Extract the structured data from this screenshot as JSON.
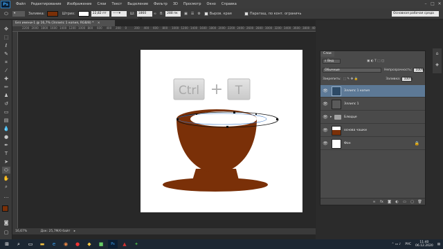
{
  "app": {
    "logo": "Ps"
  },
  "menu": [
    "Файл",
    "Редактирование",
    "Изображение",
    "Слои",
    "Текст",
    "Выделение",
    "Фильтр",
    "3D",
    "Просмотр",
    "Окно",
    "Справка"
  ],
  "options": {
    "fill_label": "Заливка:",
    "stroke_label": "Штрих:",
    "stroke_width": "22,82 пт",
    "w_label": "Ш:",
    "w_value": "1860 пк",
    "h_label": "В:",
    "h_value": "288 пк",
    "align_label": "Выров. края",
    "constrain_label": "Паратащ. по конт. ограничь",
    "workspace": "Основная рабочая среда",
    "fill_color": "#7a3008",
    "stroke_color": "#ffffff"
  },
  "document": {
    "tab_title": "Без имени-1 @ 16,7% (Эллипс 1 копия, RGB/8) *",
    "zoom": "16,67%",
    "doc_info": "Док: 25,7M/0 байт"
  },
  "ruler_ticks": [
    "2200",
    "2000",
    "1800",
    "1600",
    "1400",
    "1200",
    "1000",
    "800",
    "600",
    "400",
    "200",
    "0",
    "200",
    "400",
    "600",
    "800",
    "1000",
    "1200",
    "1400",
    "1600",
    "1800",
    "2000",
    "2200",
    "2400",
    "2600",
    "2800",
    "3000",
    "3200",
    "3400",
    "3600",
    "3800",
    "4000"
  ],
  "canvas_art": {
    "ctrl_key": "Ctrl",
    "plus": "+",
    "t_key": "T",
    "cup_color": "#7a3008"
  },
  "layers_panel": {
    "tab": "Слои",
    "kind_label": "Вид",
    "blend_mode": "Обычные",
    "opacity_label": "Непрозрачность:",
    "opacity_value": "100%",
    "lock_label": "Закрепить:",
    "fill_label": "Заливка:",
    "fill_value": "100%",
    "layers": [
      {
        "name": "Эллипс 1 копия",
        "selected": true
      },
      {
        "name": "Эллипс 1",
        "selected": false
      },
      {
        "name": "Блюдце",
        "selected": false
      },
      {
        "name": "основа чашки",
        "selected": false
      },
      {
        "name": "Фон",
        "selected": false
      }
    ]
  },
  "taskbar": {
    "lang": "РУС",
    "time": "11:40",
    "date": "06.12.2020"
  }
}
